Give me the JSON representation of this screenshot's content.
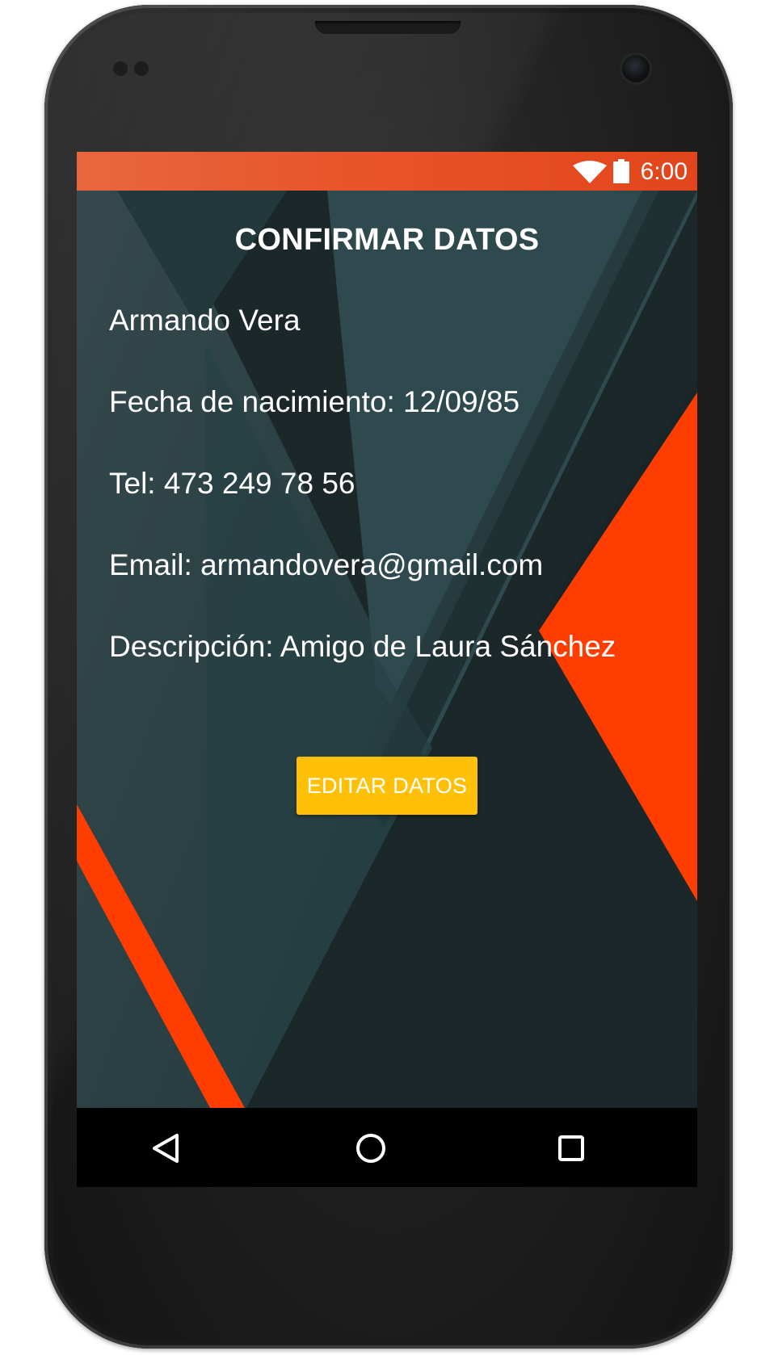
{
  "status_bar": {
    "time": "6:00",
    "icons": [
      "wifi-icon",
      "battery-icon"
    ]
  },
  "screen": {
    "title": "CONFIRMAR DATOS",
    "fields": {
      "name": "Armando Vera",
      "birthdate": "Fecha de nacimiento: 12/09/85",
      "phone": "Tel: 473 249 78 56",
      "email": "Email: armandovera@gmail.com",
      "description": "Descripción: Amigo de Laura Sánchez"
    },
    "edit_button_label": "EDITAR DATOS"
  },
  "nav_bar": {
    "icons": [
      "back-icon",
      "home-icon",
      "recents-icon"
    ]
  },
  "colors": {
    "status_bar": "#e8542a",
    "background_dark": "#1b2729",
    "background_teal": "#2e4b4f",
    "accent_orange": "#ff3d00",
    "button": "#ffc107"
  }
}
